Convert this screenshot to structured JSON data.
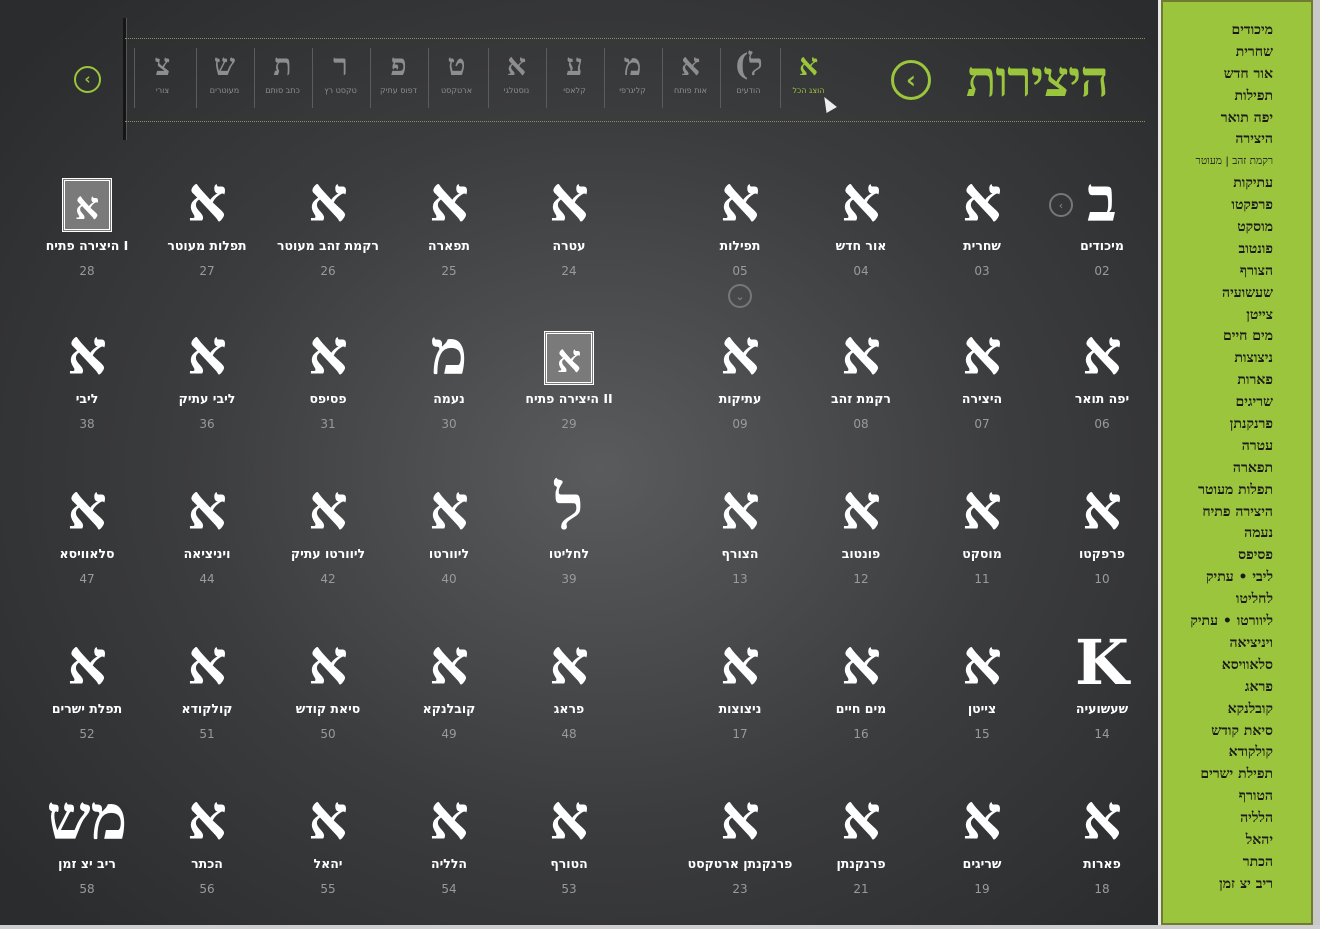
{
  "header": {
    "title": "היצירות"
  },
  "filters": [
    {
      "glyph": "א",
      "label": "הוצג הכל",
      "active": true
    },
    {
      "glyph": "(ל",
      "label": "הודעים"
    },
    {
      "glyph": "א",
      "label": "אות פותח"
    },
    {
      "glyph": "מ",
      "label": "קליגרפי"
    },
    {
      "glyph": "ע",
      "label": "קלאסי"
    },
    {
      "glyph": "א",
      "label": "נוסטלגי"
    },
    {
      "glyph": "ט",
      "label": "ארטקסט"
    },
    {
      "glyph": "פ",
      "label": "דפוס עתיק"
    },
    {
      "glyph": "ר",
      "label": "טקסט רץ"
    },
    {
      "glyph": "ת",
      "label": "כתב סותם"
    },
    {
      "glyph": "ש",
      "label": "מעוטרים"
    },
    {
      "glyph": "צ",
      "label": "צורי"
    }
  ],
  "fonts": [
    {
      "glyph": "ב",
      "name": "מיכודים",
      "num": "02"
    },
    {
      "glyph": "א",
      "name": "שחרית",
      "num": "03"
    },
    {
      "glyph": "א",
      "name": "אור חדש",
      "num": "04"
    },
    {
      "glyph": "א",
      "name": "תפילות",
      "num": "05"
    },
    {
      "glyph": "א",
      "name": "עטרה",
      "num": "24"
    },
    {
      "glyph": "א",
      "name": "תפארה",
      "num": "25"
    },
    {
      "glyph": "א",
      "name": "רקמת זהב מעוטר",
      "num": "26"
    },
    {
      "glyph": "א",
      "name": "תפלות מעוטר",
      "num": "27"
    },
    {
      "glyph": "א",
      "name": "היצירה פתיח I",
      "num": "28",
      "boxed": true
    },
    {
      "glyph": "א",
      "name": "יפה תואר",
      "num": "06"
    },
    {
      "glyph": "א",
      "name": "היצירה",
      "num": "07"
    },
    {
      "glyph": "א",
      "name": "רקמת זהב",
      "num": "08"
    },
    {
      "glyph": "א",
      "name": "עתיקות",
      "num": "09"
    },
    {
      "glyph": "א",
      "name": "היצירה פתיח II",
      "num": "29",
      "boxed": true
    },
    {
      "glyph": "מ",
      "name": "נעמה",
      "num": "30"
    },
    {
      "glyph": "א",
      "name": "פסיפס",
      "num": "31"
    },
    {
      "glyph": "א",
      "name": "ליבי עתיק",
      "num": "36"
    },
    {
      "glyph": "א",
      "name": "ליבי",
      "num": "38"
    },
    {
      "glyph": "א",
      "name": "פרפקטו",
      "num": "10"
    },
    {
      "glyph": "א",
      "name": "מוסקט",
      "num": "11"
    },
    {
      "glyph": "א",
      "name": "פונטוב",
      "num": "12"
    },
    {
      "glyph": "א",
      "name": "הצורף",
      "num": "13"
    },
    {
      "glyph": "ל",
      "name": "לחליטו",
      "num": "39"
    },
    {
      "glyph": "א",
      "name": "ליוורטו",
      "num": "40"
    },
    {
      "glyph": "א",
      "name": "ליוורטו עתיק",
      "num": "42"
    },
    {
      "glyph": "א",
      "name": "ויניציאה",
      "num": "44"
    },
    {
      "glyph": "א",
      "name": "סלאוויסא",
      "num": "47"
    },
    {
      "glyph": "K",
      "name": "שעשועיה",
      "num": "14"
    },
    {
      "glyph": "א",
      "name": "צייטן",
      "num": "15"
    },
    {
      "glyph": "א",
      "name": "מים חיים",
      "num": "16"
    },
    {
      "glyph": "א",
      "name": "ניצוצות",
      "num": "17"
    },
    {
      "glyph": "א",
      "name": "פראג",
      "num": "48"
    },
    {
      "glyph": "א",
      "name": "קובלנקא",
      "num": "49"
    },
    {
      "glyph": "א",
      "name": "סיאת קודש",
      "num": "50"
    },
    {
      "glyph": "א",
      "name": "קולקודא",
      "num": "51"
    },
    {
      "glyph": "א",
      "name": "תפלת ישרים",
      "num": "52"
    },
    {
      "glyph": "א",
      "name": "פארות",
      "num": "18"
    },
    {
      "glyph": "א",
      "name": "שריגים",
      "num": "19"
    },
    {
      "glyph": "א",
      "name": "פרנקנתן",
      "num": "21"
    },
    {
      "glyph": "א",
      "name": "פרנקנתן ארטקסט",
      "num": "23"
    },
    {
      "glyph": "א",
      "name": "הטורף",
      "num": "53"
    },
    {
      "glyph": "א",
      "name": "הלליה",
      "num": "54"
    },
    {
      "glyph": "א",
      "name": "יהאל",
      "num": "55"
    },
    {
      "glyph": "א",
      "name": "הכתר",
      "num": "56"
    },
    {
      "glyph": "מש",
      "name": "ריב יצ זמן",
      "num": "58"
    }
  ],
  "sidebar": [
    "מיכודים",
    "שחרית",
    "אור חדש",
    "תפילות",
    "יפה תואר",
    "היצירה",
    "רקמת זהב | מעוטר",
    "עתיקות",
    "פרפקטו",
    "מוסקט",
    "פונטוב",
    "הצורף",
    "שעשועיה",
    "צייטן",
    "מים חיים",
    "ניצוצות",
    "פארות",
    "שריגים",
    "פרנקנתן",
    "עטרה",
    "תפארה",
    "תפלות מעוטר",
    "היצירה פתיח",
    "נעמה",
    "פסיפס",
    "ליבי • עתיק",
    "לחליטו",
    "ליוורטו • עתיק",
    "ויניציאה",
    "סלאוויסא",
    "פראג",
    "קובלנקא",
    "סיאת קודש",
    "קולקודא",
    "תפילת ישרים",
    "הטורף",
    "הלליה",
    "יהאל",
    "הכתר",
    "ריב יצ זמן"
  ],
  "colors": {
    "accent": "#9bc53d",
    "background": "#3b3c3e",
    "text": "#ffffff",
    "muted": "#9a9a9a"
  },
  "icons": {
    "back": "chevron-left-icon",
    "scroll_down": "chevron-down-icon"
  }
}
